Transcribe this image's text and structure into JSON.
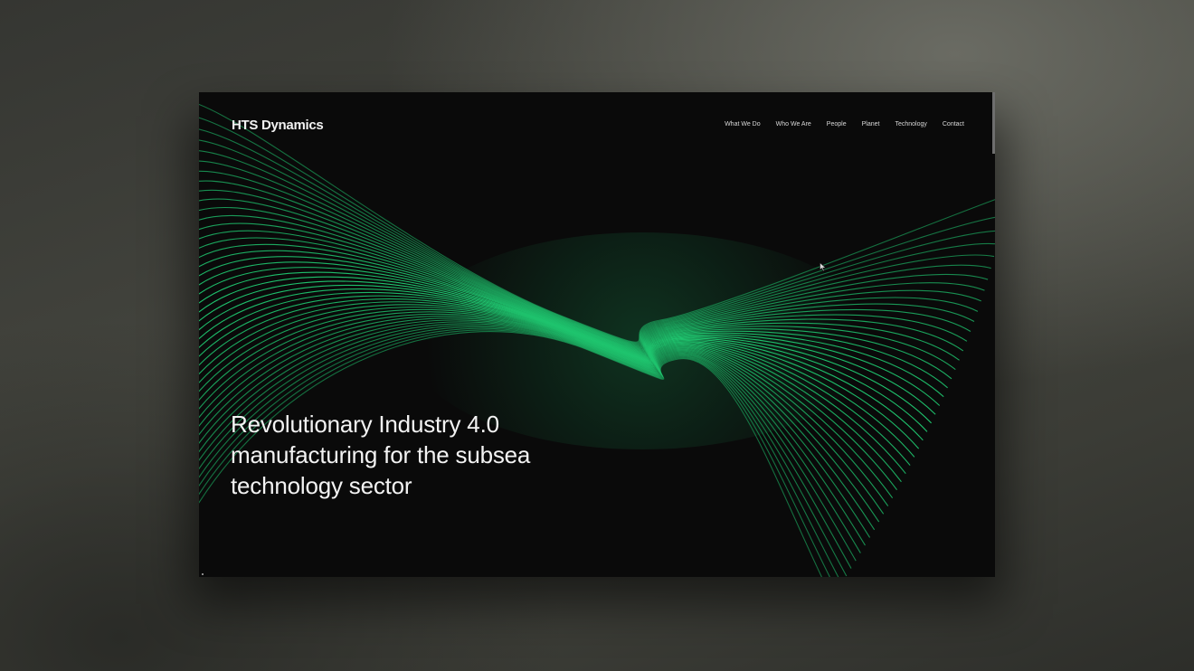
{
  "site": {
    "logo": "HTS Dynamics",
    "nav": [
      {
        "label": "What We Do"
      },
      {
        "label": "Who We Are"
      },
      {
        "label": "People"
      },
      {
        "label": "Planet"
      },
      {
        "label": "Technology"
      },
      {
        "label": "Contact"
      }
    ],
    "hero": {
      "line1": "Revolutionary Industry 4.0",
      "line2": "manufacturing for the subsea",
      "line3": "technology sector"
    }
  },
  "colors": {
    "accent": "#1fc46e",
    "background": "#0a0a0a",
    "text": "#f3f3f3"
  },
  "icons": {
    "cursor": "arrow-cursor-icon"
  }
}
